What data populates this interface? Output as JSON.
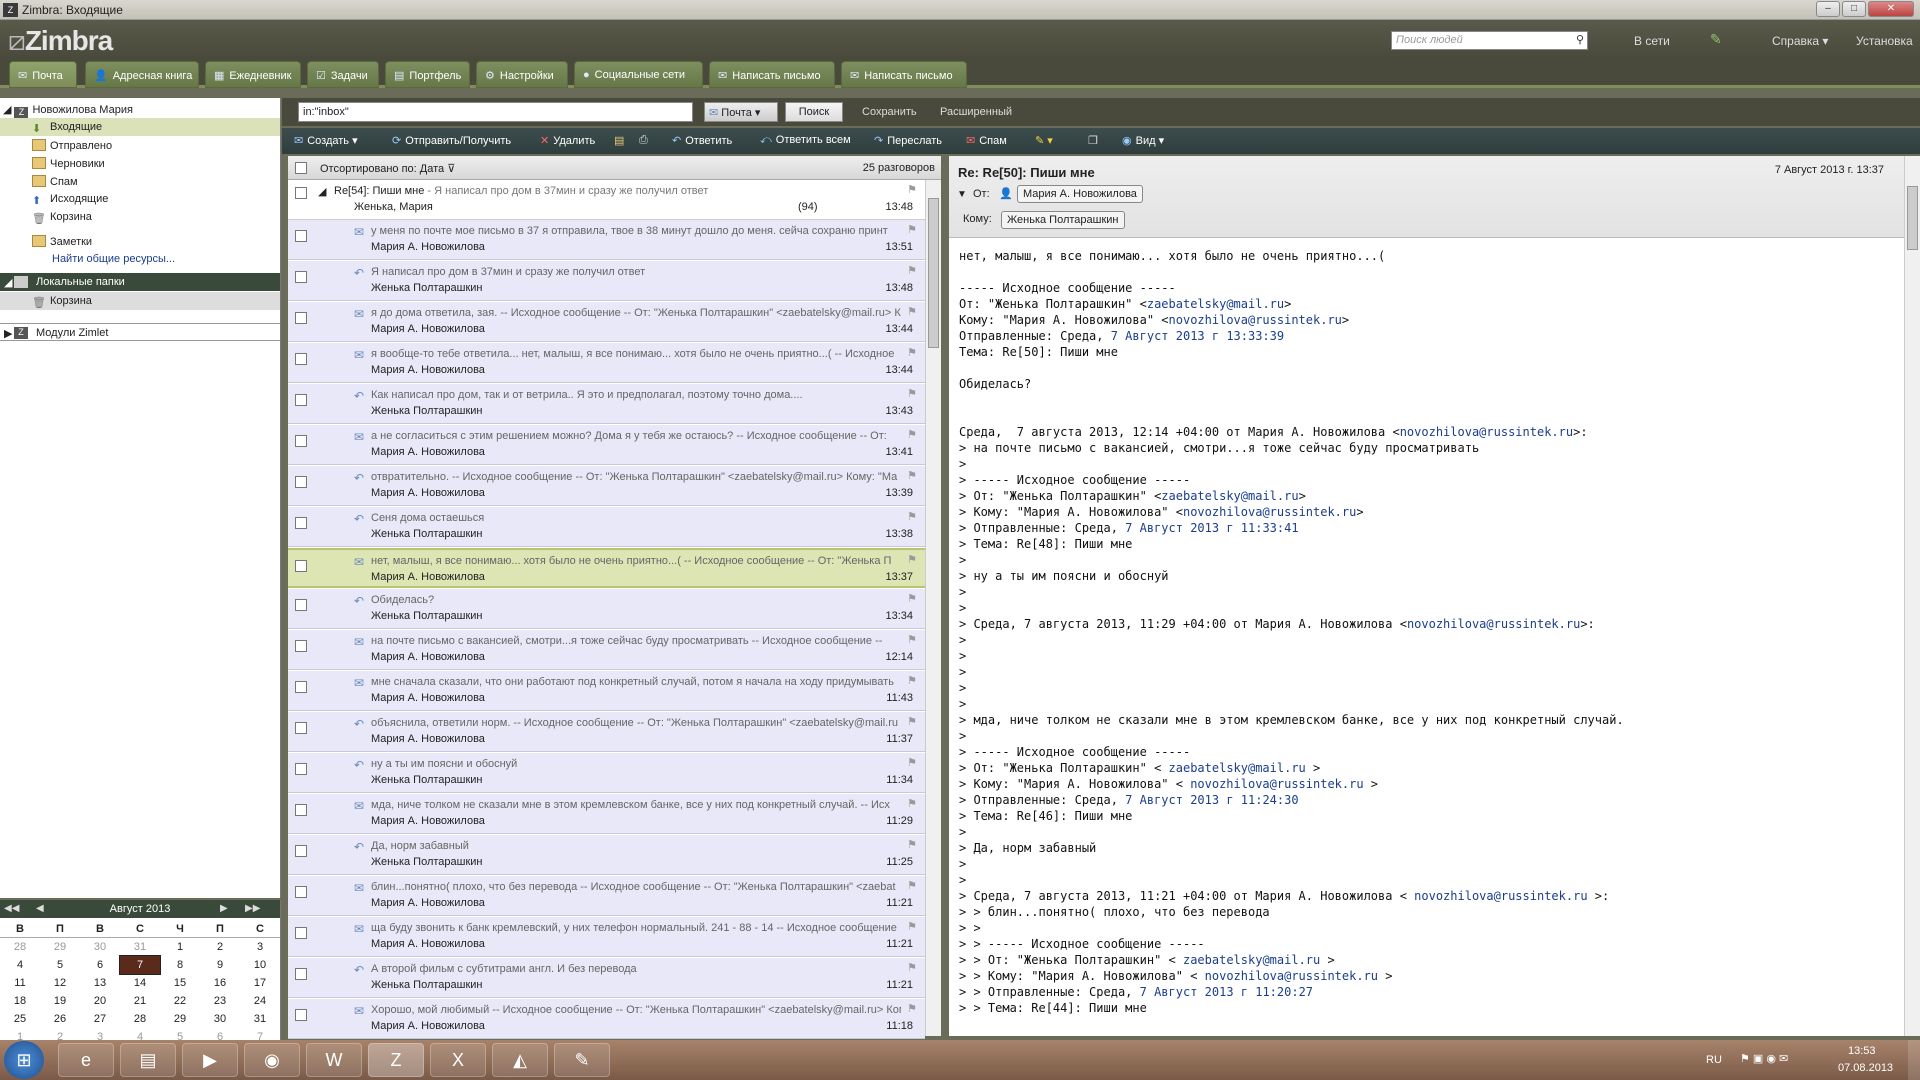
{
  "window": {
    "title": "Zimbra: Входящие"
  },
  "header": {
    "logo": "Zimbra",
    "search_placeholder": "Поиск людей",
    "status": "В сети",
    "help": "Справка",
    "setup": "Установка"
  },
  "tabs": [
    {
      "label": "Почта"
    },
    {
      "label": "Адресная книга"
    },
    {
      "label": "Ежедневник"
    },
    {
      "label": "Задачи"
    },
    {
      "label": "Портфель"
    },
    {
      "label": "Настройки"
    },
    {
      "label": "Социальные сети"
    },
    {
      "label": "Написать письмо"
    },
    {
      "label": "Написать письмо"
    }
  ],
  "folders": {
    "account": "Новожилова Мария",
    "items": [
      {
        "label": "Входящие"
      },
      {
        "label": "Отправлено"
      },
      {
        "label": "Черновики"
      },
      {
        "label": "Спам"
      },
      {
        "label": "Исходящие"
      },
      {
        "label": "Корзина"
      },
      {
        "label": "Заметки"
      }
    ],
    "find_shares": "Найти общие ресурсы...",
    "local_folders": "Локальные папки",
    "local_trash": "Корзина",
    "zimlets": "Модули Zimlet"
  },
  "calendar": {
    "month": "Август 2013",
    "dow": [
      "В",
      "П",
      "В",
      "С",
      "Ч",
      "П",
      "С"
    ],
    "weeks": [
      [
        "28",
        "29",
        "30",
        "31",
        "1",
        "2",
        "3"
      ],
      [
        "4",
        "5",
        "6",
        "7",
        "8",
        "9",
        "10"
      ],
      [
        "11",
        "12",
        "13",
        "14",
        "15",
        "16",
        "17"
      ],
      [
        "18",
        "19",
        "20",
        "21",
        "22",
        "23",
        "24"
      ],
      [
        "25",
        "26",
        "27",
        "28",
        "29",
        "30",
        "31"
      ],
      [
        "1",
        "2",
        "3",
        "4",
        "5",
        "6",
        "7"
      ]
    ]
  },
  "search": {
    "query": "in:\"inbox\"",
    "scope": "Почта",
    "button": "Поиск",
    "save": "Сохранить",
    "advanced": "Расширенный"
  },
  "toolbar": {
    "create": "Создать",
    "send_receive": "Отправить/Получить",
    "delete": "Удалить",
    "reply": "Ответить",
    "reply_all": "Ответить всем",
    "forward": "Переслать",
    "spam": "Спам",
    "view": "Вид"
  },
  "list": {
    "sort_label": "Отсортировано по: Дата",
    "count": "25 разговоров",
    "conversation": {
      "subject": "Re[54]: Пиши мне",
      "snippet": " - Я написал про дом в 37мин и сразу же получил ответ",
      "from": "Женька, Мария",
      "count": "(94)",
      "time": "13:48"
    },
    "messages": [
      {
        "from": "Мария А. Новожилова",
        "snippet": "у меня по почте мое письмо в 37 я отправила, твое в 38 минут дошло до меня. сейча сохраню принт",
        "time": "13:51",
        "icon": "✉"
      },
      {
        "from": "Женька Полтарашкин",
        "snippet": "Я написал про дом в 37мин и сразу же получил ответ",
        "time": "13:48",
        "icon": "↶"
      },
      {
        "from": "Мария А. Новожилова",
        "snippet": "я до дома ответила, зая. -- Исходное сообщение -- От: \"Женька Полтарашкин\" <zaebatelsky@mail.ru> Ко",
        "time": "13:44",
        "icon": "✉"
      },
      {
        "from": "Мария А. Новожилова",
        "snippet": "я вообще-то тебе ответила... нет, малыш, я все понимаю... хотя было не очень приятно...( -- Исходное",
        "time": "13:44",
        "icon": "✉"
      },
      {
        "from": "Женька Полтарашкин",
        "snippet": "Как написал про дом, так и от ветрила.. Я это и предполагал, поэтому точно дома....",
        "time": "13:43",
        "icon": "↶"
      },
      {
        "from": "Мария А. Новожилова",
        "snippet": "а не согласиться с этим решением можно? Дома я у тебя же остаюсь? -- Исходное сообщение -- От:",
        "time": "13:41",
        "icon": "✉"
      },
      {
        "from": "Мария А. Новожилова",
        "snippet": "отвратительно. -- Исходное сообщение -- От: \"Женька Полтарашкин\" <zaebatelsky@mail.ru> Кому: \"Ма",
        "time": "13:39",
        "icon": "↶"
      },
      {
        "from": "Женька Полтарашкин",
        "snippet": "Сеня дома остаешься",
        "time": "13:38",
        "icon": "↶"
      },
      {
        "from": "Мария А. Новожилова",
        "snippet": "нет, малыш, я все понимаю... хотя было не очень приятно...( -- Исходное сообщение -- От: \"Женька П",
        "time": "13:37",
        "icon": "✉"
      },
      {
        "from": "Женька Полтарашкин",
        "snippet": "Обиделась?",
        "time": "13:34",
        "icon": "↶"
      },
      {
        "from": "Мария А. Новожилова",
        "snippet": "на почте письмо с вакансией, смотри...я тоже сейчас буду просматривать -- Исходное сообщение --",
        "time": "12:14",
        "icon": "✉"
      },
      {
        "from": "Мария А. Новожилова",
        "snippet": "мне сначала сказали, что они работают под конкретный случай, потом я начала на ходу придумывать",
        "time": "11:43",
        "icon": "✉"
      },
      {
        "from": "Мария А. Новожилова",
        "snippet": "объяснила, ответили норм. -- Исходное сообщение -- От: \"Женька Полтарашкин\" <zaebatelsky@mail.ru",
        "time": "11:37",
        "icon": "↶"
      },
      {
        "from": "Женька Полтарашкин",
        "snippet": "ну а ты им поясни и обоснуй",
        "time": "11:34",
        "icon": "↶"
      },
      {
        "from": "Мария А. Новожилова",
        "snippet": "мда, ниче толком не сказали мне в этом кремлевском банке, все у них под конкретный случай. -- Исх",
        "time": "11:29",
        "icon": "✉"
      },
      {
        "from": "Женька Полтарашкин",
        "snippet": "Да, норм забавный",
        "time": "11:25",
        "icon": "↶"
      },
      {
        "from": "Мария А. Новожилова",
        "snippet": "блин...понятно( плохо, что без перевода -- Исходное сообщение -- От: \"Женька Полтарашкин\" <zaebat",
        "time": "11:21",
        "icon": "✉"
      },
      {
        "from": "Мария А. Новожилова",
        "snippet": "ща буду звонить к банк кремлевский, у них телефон нормальный. 241 - 88 - 14 -- Исходное сообщение",
        "time": "11:21",
        "icon": "✉"
      },
      {
        "from": "Женька Полтарашкин",
        "snippet": "А второй фильм с субтитрами англ. И без перевода",
        "time": "11:21",
        "icon": "↶"
      },
      {
        "from": "Мария А. Новожилова",
        "snippet": "Хорошо, мой любимый -- Исходное сообщение -- От: \"Женька Полтарашкин\" <zaebatelsky@mail.ru> Кому",
        "time": "11:18",
        "icon": "✉"
      }
    ]
  },
  "reading": {
    "subject": "Re: Re[50]: Пиши мне",
    "date": "7 Август 2013 г. 13:37",
    "from_label": "От:",
    "from": "Мария А. Новожилова",
    "to_label": "Кому:",
    "to": "Женька Полтарашкин",
    "body": [
      "нет, малыш, я все понимаю... хотя было не очень приятно...(",
      "",
      "----- Исходное сообщение -----",
      "От: \"Женька Полтарашкин\" <zaebatelsky@mail.ru>",
      "Кому: \"Мария А. Новожилова\" <novozhilova@russintek.ru>",
      "Отправленные: Среда, 7 Август 2013 г 13:33:39",
      "Тема: Re[50]: Пиши мне",
      "",
      "Обиделась?",
      "",
      "",
      "Среда,  7 августа 2013, 12:14 +04:00 от Мария А. Новожилова <novozhilova@russintek.ru>:",
      "> на почте письмо с вакансией, смотри...я тоже сейчас буду просматривать",
      ">",
      "> ----- Исходное сообщение -----",
      "> От: \"Женька Полтарашкин\" <zaebatelsky@mail.ru>",
      "> Кому: \"Мария А. Новожилова\" <novozhilova@russintek.ru>",
      "> Отправленные: Среда, 7 Август 2013 г 11:33:41",
      "> Тема: Re[48]: Пиши мне",
      ">",
      "> ну а ты им поясни и обоснуй",
      ">",
      ">",
      "> Среда, 7 августа 2013, 11:29 +04:00 от Мария А. Новожилова <novozhilova@russintek.ru>:",
      ">",
      ">",
      ">",
      ">",
      ">",
      "> мда, ниче толком не сказали мне в этом кремлевском банке, все у них под конкретный случай.",
      ">",
      "> ----- Исходное сообщение -----",
      "> От: \"Женька Полтарашкин\" < zaebatelsky@mail.ru >",
      "> Кому: \"Мария А. Новожилова\" < novozhilova@russintek.ru >",
      "> Отправленные: Среда, 7 Август 2013 г 11:24:30",
      "> Тема: Re[46]: Пиши мне",
      ">",
      "> Да, норм забавный",
      ">",
      ">",
      "> Среда, 7 августа 2013, 11:21 +04:00 от Мария А. Новожилова < novozhilova@russintek.ru >:",
      "> > блин...понятно( плохо, что без перевода",
      "> >",
      "> > ----- Исходное сообщение -----",
      "> > От: \"Женька Полтарашкин\" < zaebatelsky@mail.ru >",
      "> > Кому: \"Мария А. Новожилова\" < novozhilova@russintek.ru >",
      "> > Отправленные: Среда, 7 Август 2013 г 11:20:27",
      "> > Тема: Re[44]: Пиши мне"
    ]
  },
  "taskbar": {
    "lang": "RU",
    "time": "13:53",
    "date": "07.08.2013"
  }
}
